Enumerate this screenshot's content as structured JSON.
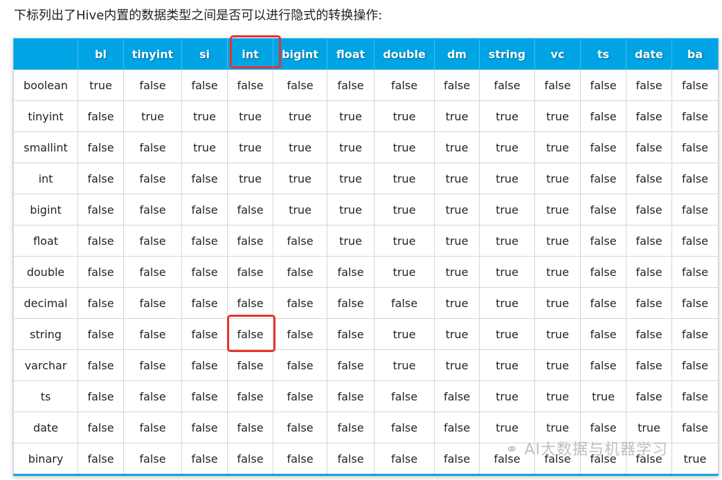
{
  "intro": "下标列出了Hive内置的数据类型之间是否可以进行隐式的转换操作:",
  "columns": [
    "",
    "bl",
    "tinyint",
    "si",
    "int",
    "bigint",
    "float",
    "double",
    "dm",
    "string",
    "vc",
    "ts",
    "date",
    "ba"
  ],
  "rows": [
    {
      "label": "boolean",
      "values": [
        "true",
        "false",
        "false",
        "false",
        "false",
        "false",
        "false",
        "false",
        "false",
        "false",
        "false",
        "false",
        "false"
      ]
    },
    {
      "label": "tinyint",
      "values": [
        "false",
        "true",
        "true",
        "true",
        "true",
        "true",
        "true",
        "true",
        "true",
        "true",
        "false",
        "false",
        "false"
      ]
    },
    {
      "label": "smallint",
      "values": [
        "false",
        "false",
        "true",
        "true",
        "true",
        "true",
        "true",
        "true",
        "true",
        "true",
        "false",
        "false",
        "false"
      ]
    },
    {
      "label": "int",
      "values": [
        "false",
        "false",
        "false",
        "true",
        "true",
        "true",
        "true",
        "true",
        "true",
        "true",
        "false",
        "false",
        "false"
      ]
    },
    {
      "label": "bigint",
      "values": [
        "false",
        "false",
        "false",
        "false",
        "true",
        "true",
        "true",
        "true",
        "true",
        "true",
        "false",
        "false",
        "false"
      ]
    },
    {
      "label": "float",
      "values": [
        "false",
        "false",
        "false",
        "false",
        "false",
        "true",
        "true",
        "true",
        "true",
        "true",
        "false",
        "false",
        "false"
      ]
    },
    {
      "label": "double",
      "values": [
        "false",
        "false",
        "false",
        "false",
        "false",
        "false",
        "true",
        "true",
        "true",
        "true",
        "false",
        "false",
        "false"
      ]
    },
    {
      "label": "decimal",
      "values": [
        "false",
        "false",
        "false",
        "false",
        "false",
        "false",
        "false",
        "true",
        "true",
        "true",
        "false",
        "false",
        "false"
      ]
    },
    {
      "label": "string",
      "values": [
        "false",
        "false",
        "false",
        "false",
        "false",
        "false",
        "true",
        "true",
        "true",
        "true",
        "false",
        "false",
        "false"
      ]
    },
    {
      "label": "varchar",
      "values": [
        "false",
        "false",
        "false",
        "false",
        "false",
        "false",
        "true",
        "true",
        "true",
        "true",
        "false",
        "false",
        "false"
      ]
    },
    {
      "label": "ts",
      "values": [
        "false",
        "false",
        "false",
        "false",
        "false",
        "false",
        "false",
        "false",
        "true",
        "true",
        "true",
        "false",
        "false"
      ]
    },
    {
      "label": "date",
      "values": [
        "false",
        "false",
        "false",
        "false",
        "false",
        "false",
        "false",
        "false",
        "true",
        "true",
        "false",
        "true",
        "false"
      ]
    },
    {
      "label": "binary",
      "values": [
        "false",
        "false",
        "false",
        "false",
        "false",
        "false",
        "false",
        "false",
        "false",
        "false",
        "false",
        "false",
        "true"
      ]
    }
  ],
  "watermark": "AI大数据与机器学习",
  "colors": {
    "header": "#00a4e4",
    "highlight": "#e8322b"
  }
}
